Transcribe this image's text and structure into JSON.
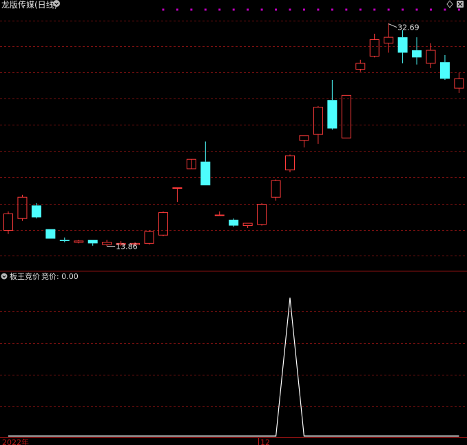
{
  "header": {
    "title": "龙版传媒(日线)",
    "right_icon": "diamond-icon",
    "right_icon2": "close-icon"
  },
  "sub_header": {
    "title": "板王竞价",
    "value_label": "竞价: 0.00"
  },
  "x_axis": {
    "labels": [
      "2022年",
      "12"
    ]
  },
  "colors": {
    "up": "#ff3b3b",
    "down": "#4dfdfd",
    "grid": "#7a1010",
    "indicator": "#ffffff",
    "marker": "#c000c0",
    "text": "#e0e0e0"
  },
  "chart_data": [
    {
      "type": "candlestick",
      "price_range": [
        12.2,
        33.6
      ],
      "max_label": "32.69",
      "min_label": "13.86",
      "candles": [
        {
          "o": 15.2,
          "h": 16.8,
          "l": 14.9,
          "c": 16.6
        },
        {
          "o": 16.2,
          "h": 18.2,
          "l": 16.0,
          "c": 18.0
        },
        {
          "o": 17.3,
          "h": 17.5,
          "l": 16.2,
          "c": 16.3
        },
        {
          "o": 15.3,
          "h": 15.3,
          "l": 14.5,
          "c": 14.5
        },
        {
          "o": 14.4,
          "h": 14.6,
          "l": 14.2,
          "c": 14.3
        },
        {
          "o": 14.2,
          "h": 14.4,
          "l": 14.1,
          "c": 14.3
        },
        {
          "o": 14.4,
          "h": 14.4,
          "l": 13.9,
          "c": 14.1
        },
        {
          "o": 14.0,
          "h": 14.4,
          "l": 13.86,
          "c": 14.2
        },
        {
          "o": 14.0,
          "h": 14.3,
          "l": 13.9,
          "c": 14.1
        },
        {
          "o": 14.0,
          "h": 14.2,
          "l": 13.9,
          "c": 14.1
        },
        {
          "o": 14.1,
          "h": 15.2,
          "l": 14.0,
          "c": 15.1
        },
        {
          "o": 14.8,
          "h": 16.8,
          "l": 14.7,
          "c": 16.7
        },
        {
          "o": 18.8,
          "h": 18.8,
          "l": 17.6,
          "c": 18.8
        },
        {
          "o": 20.4,
          "h": 20.4,
          "l": 20.4,
          "c": 21.2
        },
        {
          "o": 21.0,
          "h": 22.7,
          "l": 19.0,
          "c": 19.0
        },
        {
          "o": 16.5,
          "h": 16.8,
          "l": 16.5,
          "c": 16.5
        },
        {
          "o": 16.1,
          "h": 16.2,
          "l": 15.5,
          "c": 15.6
        },
        {
          "o": 15.6,
          "h": 15.8,
          "l": 15.4,
          "c": 15.8
        },
        {
          "o": 15.7,
          "h": 17.5,
          "l": 15.6,
          "c": 17.4
        },
        {
          "o": 18.0,
          "h": 19.5,
          "l": 17.7,
          "c": 19.4
        },
        {
          "o": 20.3,
          "h": 21.6,
          "l": 20.1,
          "c": 21.5
        },
        {
          "o": 22.8,
          "h": 23.2,
          "l": 22.2,
          "c": 23.2
        },
        {
          "o": 23.3,
          "h": 25.7,
          "l": 22.5,
          "c": 25.6
        },
        {
          "o": 26.2,
          "h": 27.9,
          "l": 23.7,
          "c": 23.8
        },
        {
          "o": 23.0,
          "h": 26.6,
          "l": 23.0,
          "c": 26.6
        },
        {
          "o": 28.8,
          "h": 29.6,
          "l": 28.6,
          "c": 29.3
        },
        {
          "o": 29.9,
          "h": 31.8,
          "l": 29.8,
          "c": 31.3
        },
        {
          "o": 31.0,
          "h": 32.69,
          "l": 30.2,
          "c": 31.5
        },
        {
          "o": 31.5,
          "h": 32.1,
          "l": 29.3,
          "c": 30.2
        },
        {
          "o": 30.4,
          "h": 31.5,
          "l": 29.2,
          "c": 29.8
        },
        {
          "o": 29.3,
          "h": 31.0,
          "l": 28.9,
          "c": 30.4
        },
        {
          "o": 29.4,
          "h": 30.0,
          "l": 27.9,
          "c": 28.0
        },
        {
          "o": 27.2,
          "h": 28.5,
          "l": 26.8,
          "c": 28.0
        }
      ]
    },
    {
      "type": "line",
      "series": [
        {
          "values": [
            0,
            0,
            0,
            0,
            0,
            0,
            0,
            0,
            0,
            0,
            0,
            0,
            0,
            0,
            0,
            0,
            0,
            0,
            0,
            0,
            1,
            0,
            0,
            0,
            0,
            0,
            0,
            0,
            0,
            0,
            0,
            0,
            0
          ]
        }
      ],
      "ylim": [
        0,
        1.1
      ]
    }
  ]
}
